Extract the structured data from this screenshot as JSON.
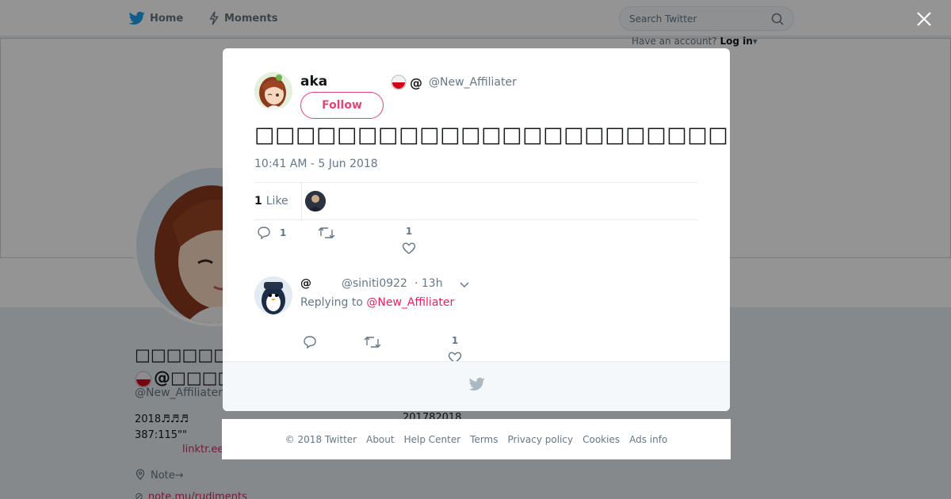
{
  "nav": {
    "home": "Home",
    "moments": "Moments",
    "search_placeholder": "Search Twitter",
    "have_account": "Have an account?",
    "login": "Log in"
  },
  "profile_bg": {
    "name_line1": "□□□□□□□□□□□",
    "name_line2": "@□□□□□□",
    "handle": "@New_Affiliater",
    "bio_line1": "2018♬♬♬",
    "bio_line2": "387:115\"\"",
    "link": "linktr.ee",
    "location": "Note→",
    "url": "note.mu/rudiments",
    "joined": "201782018"
  },
  "tweet": {
    "author_name": "aka",
    "author_emoji": "@",
    "author_handle": "@New_Affiliater",
    "follow_label": "Follow",
    "text": "□□□□□□□□□□□□□□□□□□□□□□□□□",
    "timestamp": "10:41 AM - 5 Jun 2018",
    "like_count": "1",
    "like_label": "Like",
    "reply_count": "1",
    "favorite_count": "1"
  },
  "reply": {
    "name": "@",
    "handle": "@siniti0922",
    "time": "· 13h",
    "replying_prefix": "Replying to",
    "replying_to": "@New_Affiliater",
    "favorite_count": "1"
  },
  "footer": {
    "links": [
      "© 2018 Twitter",
      "About",
      "Help Center",
      "Terms",
      "Privacy policy",
      "Cookies",
      "Ads info"
    ]
  },
  "colors": {
    "accent": "#e0245e",
    "twitter_blue": "#1da1f2",
    "overlay": "rgba(0,0,0,0.42)"
  }
}
